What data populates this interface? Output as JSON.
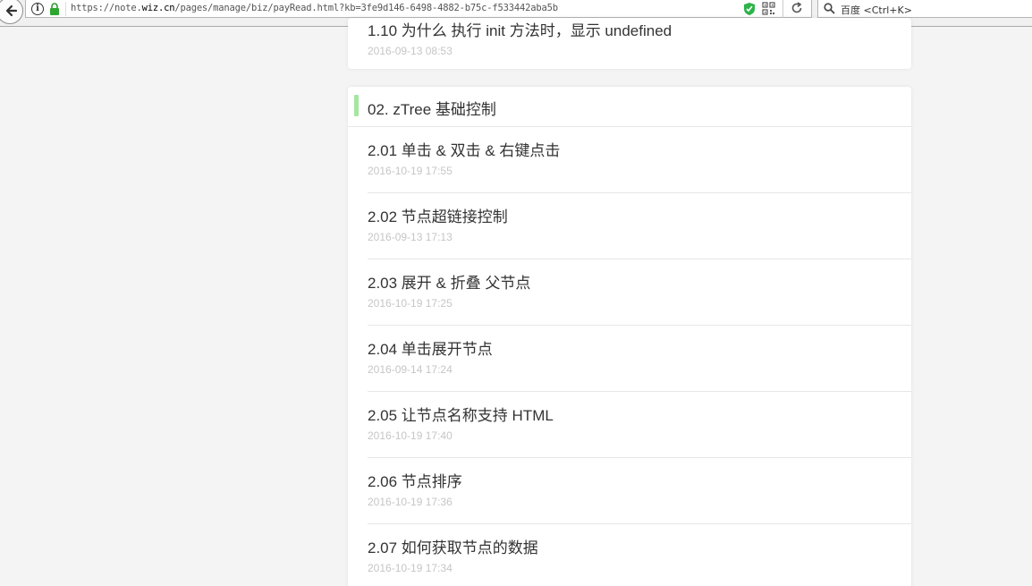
{
  "browser": {
    "url_prefix": "https://note.",
    "url_domain": "wiz.cn",
    "url_suffix": "/pages/manage/biz/payRead.html?kb=3fe9d146-6498-4882-b75c-f533442aba5b",
    "search_engine": "百度",
    "search_shortcut": "<Ctrl+K>"
  },
  "top_entry": {
    "title": "1.10 为什么 执行 init 方法时，显示 undefined",
    "date": "2016-09-13 08:53"
  },
  "section": {
    "title": "02. zTree 基础控制",
    "accent_color": "#a5e6a0",
    "entries": [
      {
        "title": "2.01 单击 & 双击 & 右键点击",
        "date": "2016-10-19 17:55"
      },
      {
        "title": "2.02 节点超链接控制",
        "date": "2016-09-13 17:13"
      },
      {
        "title": "2.03 展开 & 折叠 父节点",
        "date": "2016-10-19 17:25"
      },
      {
        "title": "2.04 单击展开节点",
        "date": "2016-09-14 17:24"
      },
      {
        "title": "2.05 让节点名称支持 HTML",
        "date": "2016-10-19 17:40"
      },
      {
        "title": "2.06 节点排序",
        "date": "2016-10-19 17:36"
      },
      {
        "title": "2.07 如何获取节点的数据",
        "date": "2016-10-19 17:34"
      }
    ]
  }
}
